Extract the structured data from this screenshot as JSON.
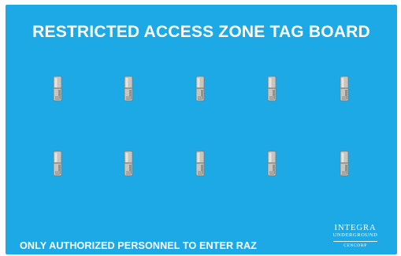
{
  "board": {
    "background_color": "#1ca9e6",
    "title": "RESTRICTED ACCESS ZONE TAG BOARD",
    "footer_text": "ONLY AUTHORIZED PERSONNEL TO ENTER RAZ",
    "hook_rows": 2,
    "hooks_per_row": 5,
    "hook_icon": "tag-hook-icon"
  },
  "logo": {
    "main": "INTEGRA",
    "sub": "UNDERGROUND",
    "small": "CENCORP"
  }
}
